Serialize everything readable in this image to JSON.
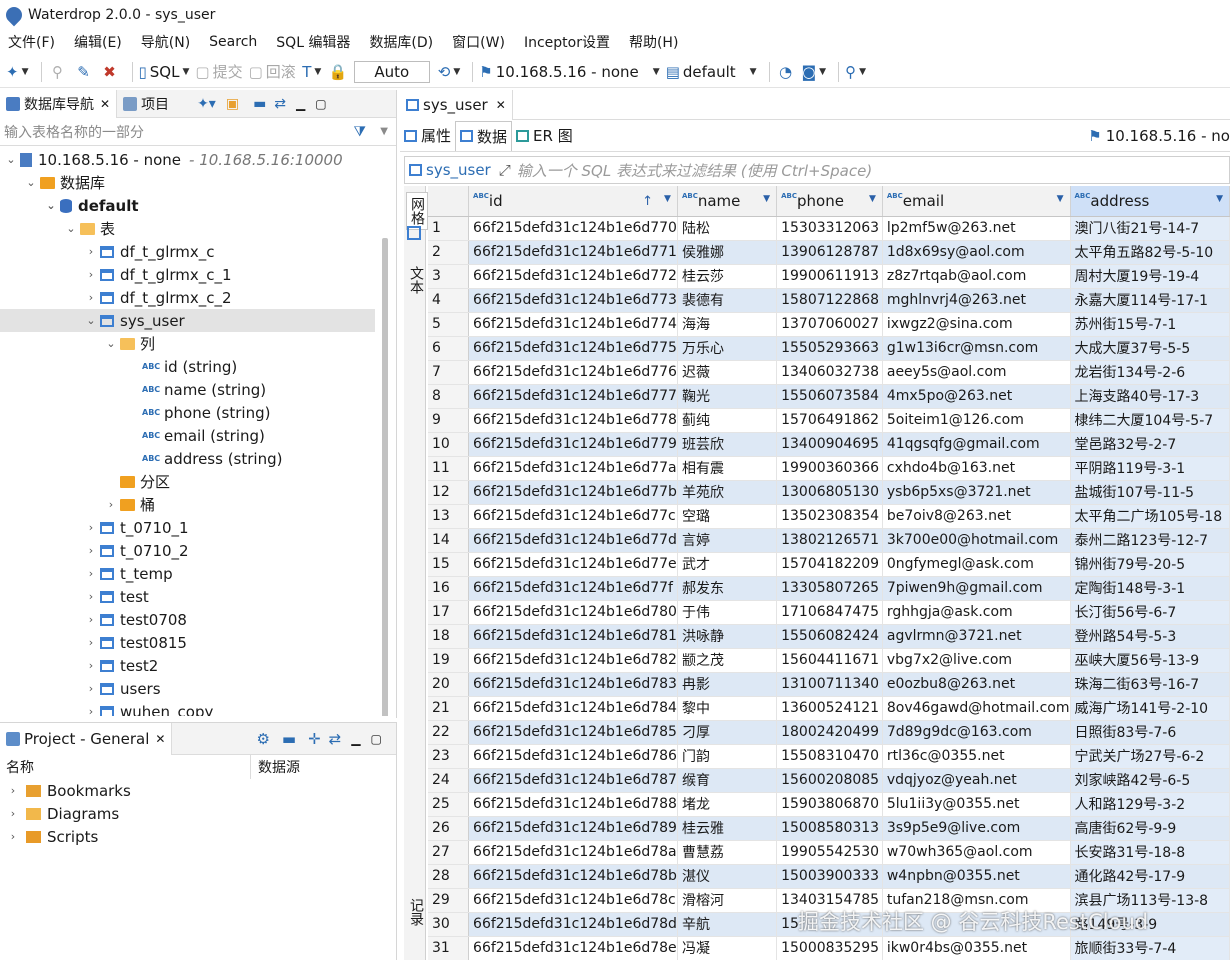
{
  "window": {
    "title": "Waterdrop 2.0.0 - sys_user"
  },
  "menu": [
    "文件(F)",
    "编辑(E)",
    "导航(N)",
    "Search",
    "SQL 编辑器",
    "数据库(D)",
    "窗口(W)",
    "Inceptor设置",
    "帮助(H)"
  ],
  "toolbar": {
    "sql_label": "SQL",
    "commit_label": "提交",
    "rollback_label": "回滚",
    "auto_label": "Auto",
    "connection": "10.168.5.16 - none",
    "schema": "default"
  },
  "left_panel": {
    "tab_nav": "数据库导航",
    "tab_project": "项目",
    "filter_placeholder": "输入表格名称的一部分",
    "tree": {
      "server": "10.168.5.16 - none",
      "server_url": "- 10.168.5.16:10000",
      "databases_folder": "数据库",
      "default_db": "default",
      "tables_folder": "表",
      "tables_before": [
        "df_t_glrmx_c",
        "df_t_glrmx_c_1",
        "df_t_glrmx_c_2"
      ],
      "selected_table": "sys_user",
      "columns_folder": "列",
      "columns": [
        "id (string)",
        "name (string)",
        "phone (string)",
        "email (string)",
        "address (string)"
      ],
      "partitions_folder": "分区",
      "buckets_folder": "桶",
      "tables_after": [
        "t_0710_1",
        "t_0710_2",
        "t_temp",
        "test",
        "test0708",
        "test0815",
        "test2",
        "users",
        "wuhen_copy"
      ]
    }
  },
  "project_panel": {
    "title": "Project - General",
    "col_name": "名称",
    "col_source": "数据源",
    "items": [
      "Bookmarks",
      "Diagrams",
      "Scripts"
    ]
  },
  "editor": {
    "tab": "sys_user",
    "sub_tabs": [
      "属性",
      "数据",
      "ER 图"
    ],
    "connection_label": "10.168.5.16 - no",
    "filter_table": "sys_user",
    "filter_placeholder": "输入一个 SQL 表达式来过滤结果 (使用 Ctrl+Space)",
    "side_tabs": [
      "网格",
      "文本",
      "记录"
    ],
    "columns": [
      "id",
      "name",
      "phone",
      "email",
      "address"
    ],
    "rows": [
      [
        "1",
        "66f215defd31c124b1e6d770",
        "陆松",
        "15303312063",
        "lp2mf5w@263.net",
        "澳门八街21号-14-7"
      ],
      [
        "2",
        "66f215defd31c124b1e6d771",
        "侯雅娜",
        "13906128787",
        "1d8x69sy@aol.com",
        "太平角五路82号-5-10"
      ],
      [
        "3",
        "66f215defd31c124b1e6d772",
        "桂云莎",
        "19900611913",
        "z8z7rtqab@aol.com",
        "周村大厦19号-19-4"
      ],
      [
        "4",
        "66f215defd31c124b1e6d773",
        "裴德有",
        "15807122868",
        "mghlnvrj4@263.net",
        "永嘉大厦114号-17-1"
      ],
      [
        "5",
        "66f215defd31c124b1e6d774",
        "海海",
        "13707060027",
        "ixwgz2@sina.com",
        "苏州街15号-7-1"
      ],
      [
        "6",
        "66f215defd31c124b1e6d775",
        "万乐心",
        "15505293663",
        "g1w13i6cr@msn.com",
        "大成大厦37号-5-5"
      ],
      [
        "7",
        "66f215defd31c124b1e6d776",
        "迟薇",
        "13406032738",
        "aeey5s@aol.com",
        "龙岩街134号-2-6"
      ],
      [
        "8",
        "66f215defd31c124b1e6d777",
        "鞠光",
        "15506073584",
        "4mx5po@263.net",
        "上海支路40号-17-3"
      ],
      [
        "9",
        "66f215defd31c124b1e6d778",
        "蓟纯",
        "15706491862",
        "5oiteim1@126.com",
        "棣纬二大厦104号-5-7"
      ],
      [
        "10",
        "66f215defd31c124b1e6d779",
        "班芸欣",
        "13400904695",
        "41qgsqfg@gmail.com",
        "堂邑路32号-2-7"
      ],
      [
        "11",
        "66f215defd31c124b1e6d77a",
        "相有震",
        "19900360366",
        "cxhdo4b@163.net",
        "平阴路119号-3-1"
      ],
      [
        "12",
        "66f215defd31c124b1e6d77b",
        "羊苑欣",
        "13006805130",
        "ysb6p5xs@3721.net",
        "盐城街107号-11-5"
      ],
      [
        "13",
        "66f215defd31c124b1e6d77c",
        "空璐",
        "13502308354",
        "be7oiv8@263.net",
        "太平角二广场105号-18"
      ],
      [
        "14",
        "66f215defd31c124b1e6d77d",
        "言婷",
        "13802126571",
        "3k700e00@hotmail.com",
        "泰州二路123号-12-7"
      ],
      [
        "15",
        "66f215defd31c124b1e6d77e",
        "武才",
        "15704182209",
        "0ngfymegl@ask.com",
        "锦州街79号-20-5"
      ],
      [
        "16",
        "66f215defd31c124b1e6d77f",
        "郝发东",
        "13305807265",
        "7piwen9h@gmail.com",
        "定陶街148号-3-1"
      ],
      [
        "17",
        "66f215defd31c124b1e6d780",
        "于伟",
        "17106847475",
        "rghhgja@ask.com",
        "长汀街56号-6-7"
      ],
      [
        "18",
        "66f215defd31c124b1e6d781",
        "洪咏静",
        "15506082424",
        "agvlrmn@3721.net",
        "登州路54号-5-3"
      ],
      [
        "19",
        "66f215defd31c124b1e6d782",
        "颛之茂",
        "15604411671",
        "vbg7x2@live.com",
        "巫峡大厦56号-13-9"
      ],
      [
        "20",
        "66f215defd31c124b1e6d783",
        "冉影",
        "13100711340",
        "e0ozbu8@263.net",
        "珠海二街63号-16-7"
      ],
      [
        "21",
        "66f215defd31c124b1e6d784",
        "黎中",
        "13600524121",
        "8ov46gawd@hotmail.com",
        "威海广场141号-2-10"
      ],
      [
        "22",
        "66f215defd31c124b1e6d785",
        "刁厚",
        "18002420499",
        "7d89g9dc@163.com",
        "日照街83号-7-6"
      ],
      [
        "23",
        "66f215defd31c124b1e6d786",
        "门韵",
        "15508310470",
        "rtl36c@0355.net",
        "宁武关广场27号-6-2"
      ],
      [
        "24",
        "66f215defd31c124b1e6d787",
        "缑育",
        "15600208085",
        "vdqjyoz@yeah.net",
        "刘家峡路42号-6-5"
      ],
      [
        "25",
        "66f215defd31c124b1e6d788",
        "堵龙",
        "15903806870",
        "5lu1ii3y@0355.net",
        "人和路129号-3-2"
      ],
      [
        "26",
        "66f215defd31c124b1e6d789",
        "桂云雅",
        "15008580313",
        "3s9p5e9@live.com",
        "高唐街62号-9-9"
      ],
      [
        "27",
        "66f215defd31c124b1e6d78a",
        "曹慧荔",
        "19905542530",
        "w70wh365@aol.com",
        "长安路31号-18-8"
      ],
      [
        "28",
        "66f215defd31c124b1e6d78b",
        "湛仪",
        "15003900333",
        "w4npbn@0355.net",
        "通化路42号-17-9"
      ],
      [
        "29",
        "66f215defd31c124b1e6d78c",
        "滑榕河",
        "13403154785",
        "tufan218@msn.com",
        "滨县广场113号-13-8"
      ],
      [
        "30",
        "66f215defd31c124b1e6d78d",
        "辛航",
        "15",
        "",
        "路149号-3-9"
      ],
      [
        "31",
        "66f215defd31c124b1e6d78e",
        "冯凝",
        "15000835295",
        "ikw0r4bs@0355.net",
        "旅顺街33号-7-4"
      ]
    ]
  },
  "watermark": "掘金技术社区 @ 谷云科技RestCloud",
  "colors": {
    "accent": "#2c6db3",
    "row_alt": "#dde8f5",
    "selected_header": "#cfe0f7"
  }
}
